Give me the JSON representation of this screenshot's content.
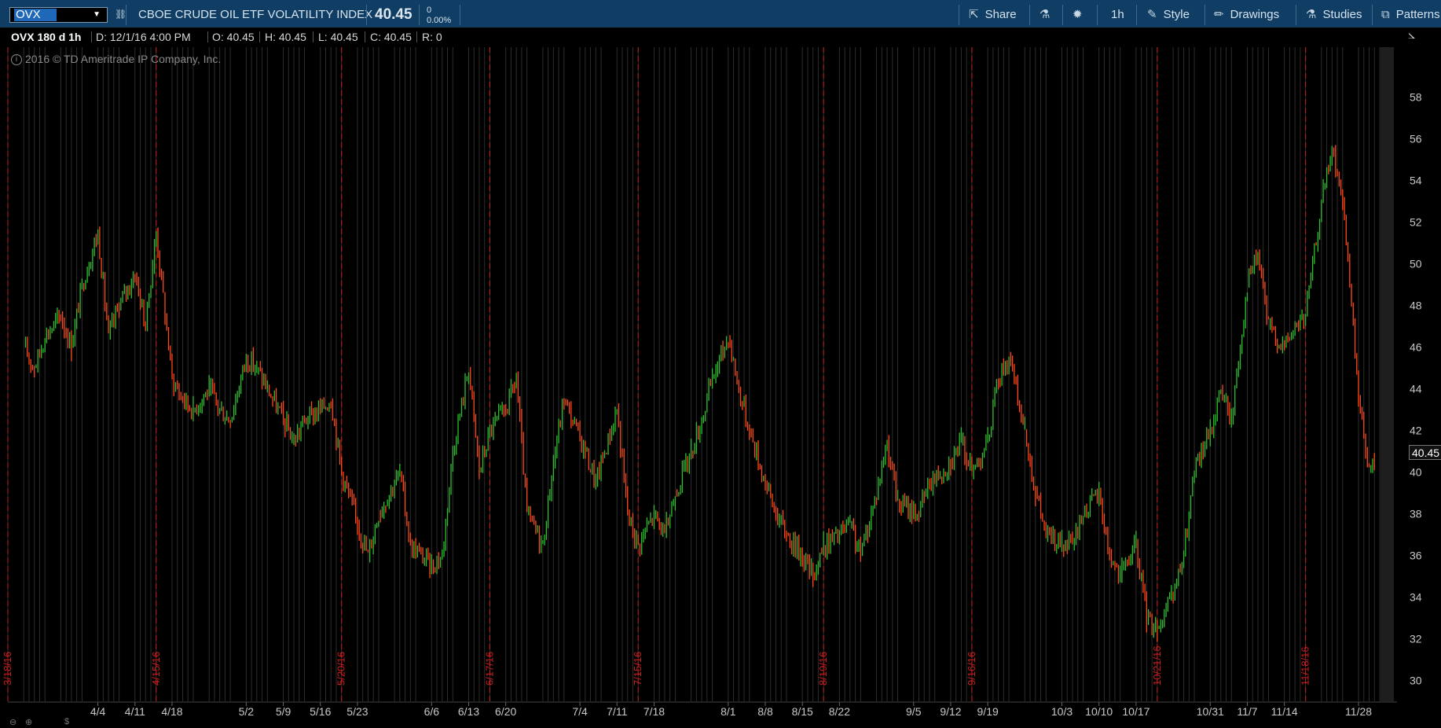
{
  "header": {
    "symbol": "OVX",
    "description": "CBOE CRUDE OIL ETF VOLATILITY INDEX",
    "last": "40.45",
    "change": "0",
    "change_pct": "0.00%",
    "buttons": {
      "share": "Share",
      "aggregation": "1h",
      "style": "Style",
      "drawings": "Drawings",
      "studies": "Studies",
      "patterns": "Patterns"
    }
  },
  "info": {
    "title": "OVX 180 d 1h",
    "date": "D: 12/1/16 4:00 PM",
    "open": "O: 40.45",
    "high": "H: 40.45",
    "low": "L: 40.45",
    "close": "C: 40.45",
    "range": "R: 0"
  },
  "copyright": "2016 © TD Ameritrade IP Company, Inc.",
  "colors": {
    "up": "#2fc02f",
    "down": "#ff4a1a",
    "expiry": "#c81e1e",
    "grid": "#2d2d2d"
  },
  "chart_data": {
    "type": "line",
    "title": "OVX 180 d 1h",
    "y_ticks": [
      30,
      32,
      34,
      36,
      38,
      40,
      42,
      44,
      46,
      48,
      50,
      52,
      54,
      56,
      58
    ],
    "ylim": [
      29.0,
      60.4
    ],
    "x_ticks": [
      "4/4",
      "4/11",
      "4/18",
      "5/2",
      "5/9",
      "5/16",
      "5/23",
      "6/6",
      "6/13",
      "6/20",
      "7/4",
      "7/11",
      "7/18",
      "8/1",
      "8/8",
      "8/15",
      "8/22",
      "9/5",
      "9/12",
      "9/19",
      "10/3",
      "10/10",
      "10/17",
      "10/31",
      "11/7",
      "11/14",
      "11/28"
    ],
    "expiry_labels": [
      "3/18/16",
      "4/15/16",
      "5/20/16",
      "6/17/16",
      "7/15/16",
      "8/19/16",
      "9/16/16",
      "10/21/16",
      "11/18/16"
    ],
    "last_value": "40.45",
    "series": [
      {
        "x": [
          "3/21",
          "3/23",
          "3/25",
          "3/28",
          "3/30",
          "4/1",
          "4/4",
          "4/6",
          "4/8",
          "4/11",
          "4/13",
          "4/15",
          "4/18",
          "4/20",
          "4/22",
          "4/25",
          "4/27",
          "4/29",
          "5/2",
          "5/4",
          "5/6",
          "5/9",
          "5/11",
          "5/13",
          "5/16",
          "5/18",
          "5/20",
          "5/23",
          "5/25",
          "5/27",
          "5/31",
          "6/2",
          "6/6",
          "6/8",
          "6/10",
          "6/13",
          "6/15",
          "6/17",
          "6/20",
          "6/22",
          "6/24",
          "6/27",
          "6/29",
          "7/1",
          "7/5",
          "7/7",
          "7/11",
          "7/13",
          "7/15",
          "7/18",
          "7/20",
          "7/22",
          "7/25",
          "7/27",
          "7/29",
          "8/1",
          "8/3",
          "8/5",
          "8/8",
          "8/10",
          "8/12",
          "8/15",
          "8/17",
          "8/19",
          "8/22",
          "8/24",
          "8/26",
          "8/29",
          "8/31",
          "9/2",
          "9/6",
          "9/8",
          "9/12",
          "9/14",
          "9/16",
          "9/19",
          "9/21",
          "9/23",
          "9/26",
          "9/28",
          "9/30",
          "10/3",
          "10/5",
          "10/7",
          "10/10",
          "10/12",
          "10/14",
          "10/17",
          "10/19",
          "10/21",
          "10/24",
          "10/26",
          "10/28",
          "10/31",
          "11/2",
          "11/4",
          "11/7",
          "11/9",
          "11/11",
          "11/14",
          "11/16",
          "11/18",
          "11/21",
          "11/23",
          "11/25",
          "11/28",
          "11/30",
          "12/1"
        ],
        "y": [
          46.0,
          45.0,
          46.5,
          47.5,
          46.0,
          49.0,
          51.5,
          46.5,
          48.0,
          49.5,
          47.0,
          51.5,
          44.5,
          43.5,
          43.0,
          44.0,
          43.0,
          42.5,
          45.5,
          45.0,
          44.0,
          42.5,
          41.5,
          42.5,
          43.0,
          43.5,
          40.0,
          37.5,
          36.0,
          38.0,
          40.0,
          36.5,
          35.5,
          36.0,
          41.0,
          45.0,
          40.0,
          42.0,
          43.0,
          44.5,
          38.0,
          36.5,
          40.5,
          43.5,
          41.0,
          39.5,
          43.0,
          38.0,
          36.5,
          38.0,
          37.0,
          39.0,
          41.0,
          42.5,
          44.5,
          46.5,
          44.0,
          42.0,
          39.5,
          38.0,
          37.0,
          36.0,
          35.0,
          36.5,
          37.0,
          37.5,
          36.0,
          39.0,
          41.5,
          38.5,
          38.0,
          39.5,
          40.5,
          41.5,
          40.0,
          41.5,
          44.5,
          45.5,
          42.0,
          39.0,
          37.0,
          36.5,
          36.5,
          38.0,
          39.0,
          36.0,
          35.0,
          36.5,
          33.0,
          32.5,
          34.0,
          36.0,
          40.0,
          42.0,
          44.0,
          42.5,
          49.0,
          50.5,
          47.0,
          46.0,
          47.0,
          47.5,
          53.0,
          55.5,
          53.0,
          43.5,
          40.0,
          40.45
        ]
      }
    ]
  }
}
